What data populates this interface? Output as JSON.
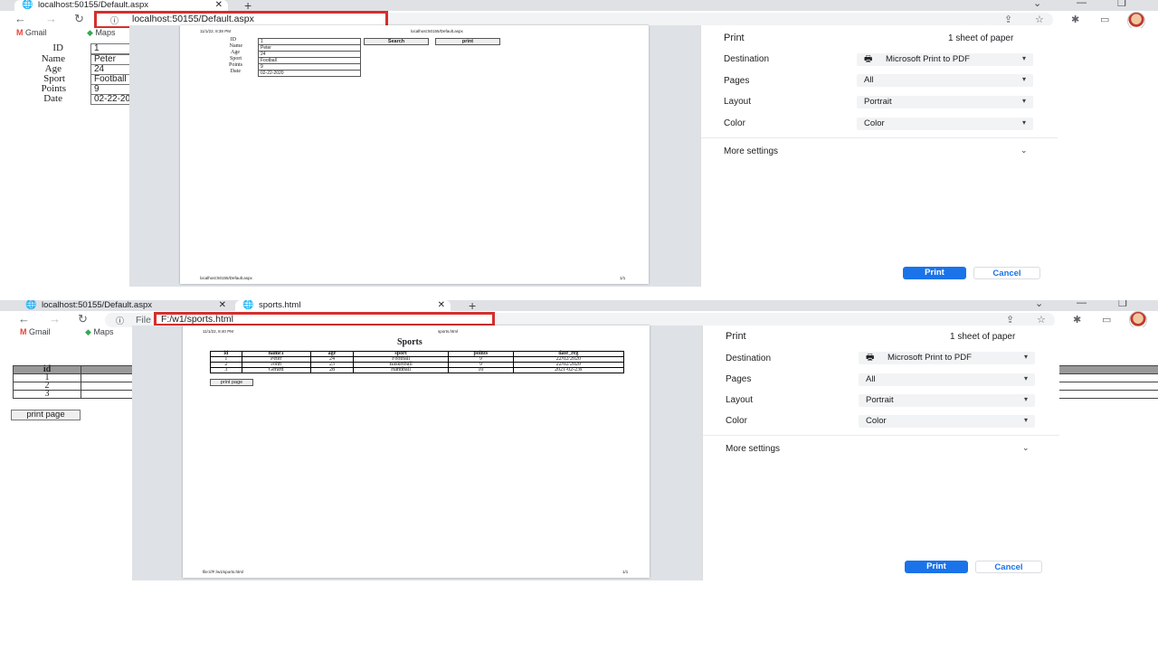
{
  "top": {
    "tab": {
      "title": "localhost:50155/Default.aspx"
    },
    "url": "localhost:50155/Default.aspx",
    "bookmarks": [
      "Gmail",
      "Maps"
    ],
    "form": [
      {
        "label": "ID",
        "value": "1"
      },
      {
        "label": "Name",
        "value": "Peter"
      },
      {
        "label": "Age",
        "value": "24"
      },
      {
        "label": "Sport",
        "value": "Football"
      },
      {
        "label": "Points",
        "value": "9"
      },
      {
        "label": "Date",
        "value": "02-22-2020"
      }
    ],
    "preview": {
      "header_left": "11/1/22, 8:38 PM",
      "header_right": "localhost:50155/Default.aspx",
      "search_label": "Search",
      "print_label": "print",
      "footer_left": "localhost:50155/Default.aspx",
      "footer_right": "1/1"
    },
    "print": {
      "title": "Print",
      "sheets": "1 sheet of paper",
      "destination_label": "Destination",
      "destination_value": "Microsoft Print to PDF",
      "pages_label": "Pages",
      "pages_value": "All",
      "layout_label": "Layout",
      "layout_value": "Portrait",
      "color_label": "Color",
      "color_value": "Color",
      "more_settings": "More settings",
      "print_button": "Print",
      "cancel_button": "Cancel"
    }
  },
  "bottom": {
    "tabs": [
      {
        "title": "localhost:50155/Default.aspx"
      },
      {
        "title": "sports.html"
      }
    ],
    "url_prefix": "File",
    "url": "F:/w1/sports.html",
    "bookmarks": [
      "Gmail",
      "Maps"
    ],
    "bg_table": {
      "header": "id",
      "rows": [
        "1",
        "2",
        "3"
      ]
    },
    "print_page_button": "print page",
    "preview": {
      "header_left": "11/1/22, 8:40 PM",
      "header_right": "sports.html",
      "title": "Sports",
      "columns": [
        "id",
        "name1",
        "age",
        "sport",
        "points",
        "date_reg"
      ],
      "rows": [
        [
          "1",
          "Peter",
          "24",
          "Football",
          "9",
          "22/02/2020"
        ],
        [
          "2",
          "John",
          "23",
          "Basketball",
          "9",
          "22/02/2020"
        ],
        [
          "3",
          "Gerard",
          "28",
          "Handball",
          "10",
          "2021-02-23s"
        ]
      ],
      "print_page_label": "print page",
      "footer_left": "file:///F:/w1/sports.html",
      "footer_right": "1/1"
    },
    "print": {
      "title": "Print",
      "sheets": "1 sheet of paper",
      "destination_label": "Destination",
      "destination_value": "Microsoft Print to PDF",
      "pages_label": "Pages",
      "pages_value": "All",
      "layout_label": "Layout",
      "layout_value": "Portrait",
      "color_label": "Color",
      "color_value": "Color",
      "more_settings": "More settings",
      "print_button": "Print",
      "cancel_button": "Cancel"
    }
  },
  "colors": {
    "accent": "#1a73e8",
    "highlight": "#d32f2f",
    "dimmer": "#dee1e6"
  }
}
